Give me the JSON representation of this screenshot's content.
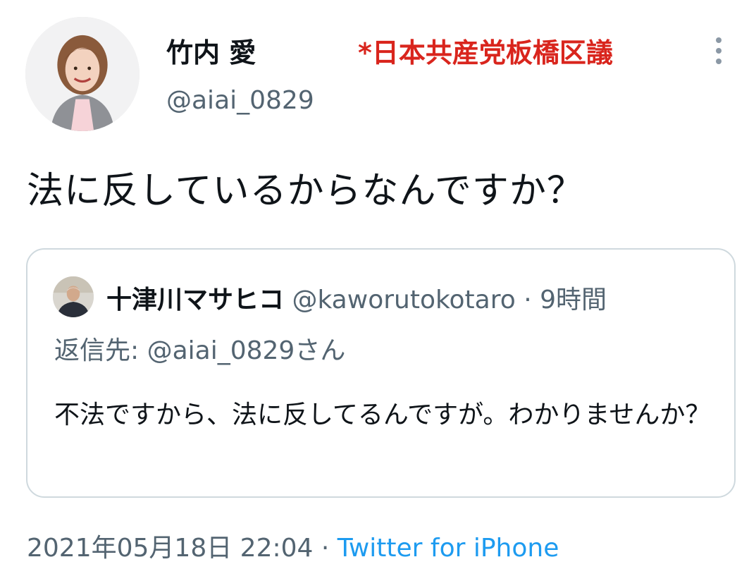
{
  "author": {
    "name": "竹内 愛",
    "annotation": "*日本共産党板橋区議",
    "handle": "@aiai_0829"
  },
  "tweet": {
    "text": "法に反しているからなんですか？"
  },
  "quoted": {
    "name": "十津川マサヒコ",
    "handle": "@kaworutokotaro",
    "separator": "·",
    "time": "9時間",
    "reply_to": "返信先: @aiai_0829さん",
    "text": "不法ですから、法に反してるんですが。わかりませんか？"
  },
  "footer": {
    "date": "2021年05月18日 22:04",
    "separator": "·",
    "source": "Twitter for iPhone"
  },
  "icons": {
    "more": "more-vertical-icon"
  },
  "colors": {
    "annotation": "#d9251d",
    "link": "#1d9bf0",
    "muted": "#536471",
    "border": "#cfd9de"
  }
}
